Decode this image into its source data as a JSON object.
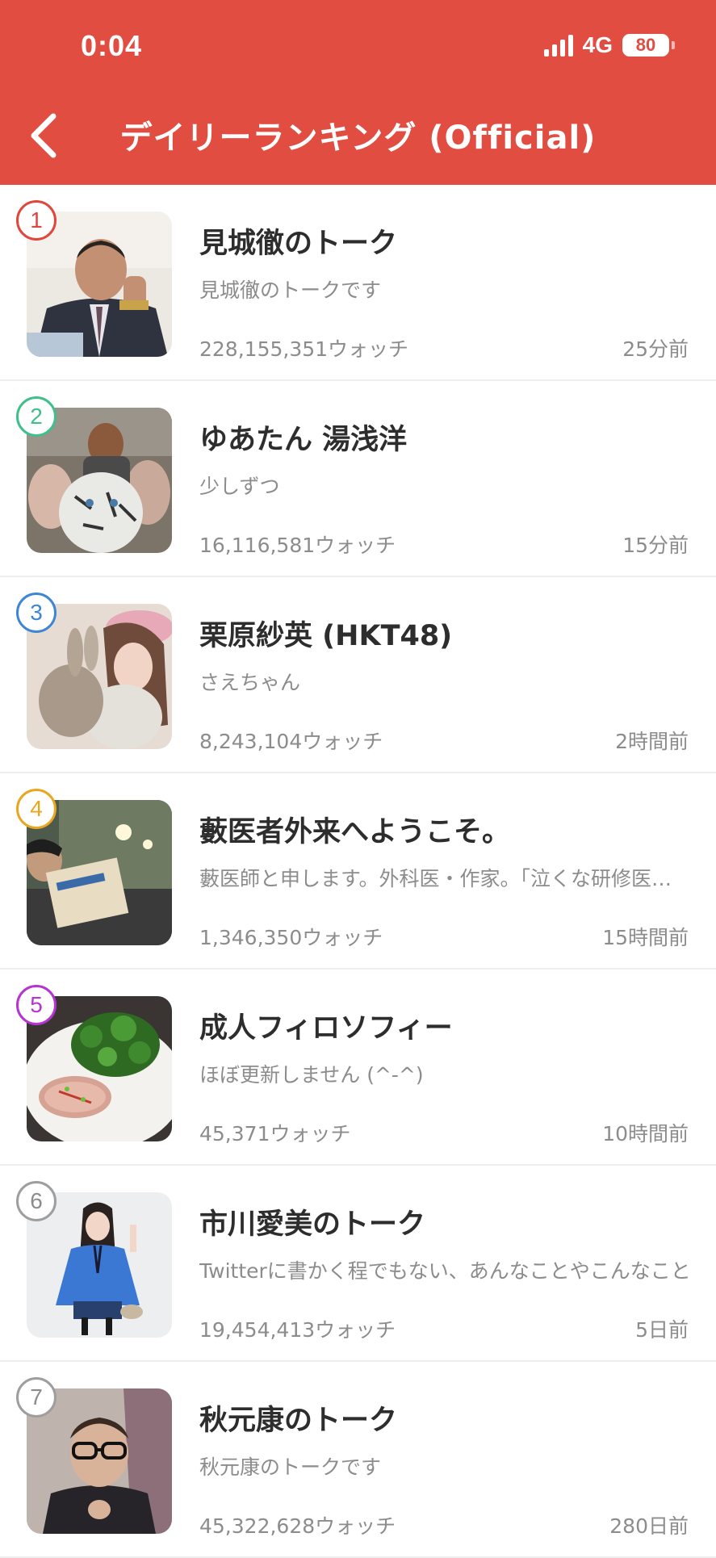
{
  "status_bar": {
    "time": "0:04",
    "network": "4G",
    "battery": "80"
  },
  "header": {
    "title": "デイリーランキング (Official)",
    "back_icon": "chevron-left-icon",
    "color": "#e14d40"
  },
  "rankings": [
    {
      "rank": "1",
      "rank_color": "#e0463b",
      "name": "見城徹のトーク",
      "description": "見城徹のトークです",
      "watchers": "228,155,351ウォッチ",
      "time_ago": "25分前"
    },
    {
      "rank": "2",
      "rank_color": "#3fbf8a",
      "name": "ゆあたん 湯浅洋",
      "description": "少しずつ",
      "watchers": "16,116,581ウォッチ",
      "time_ago": "15分前"
    },
    {
      "rank": "3",
      "rank_color": "#3d86d6",
      "name": "栗原紗英 (HKT48)",
      "description": "さえちゃん",
      "watchers": "8,243,104ウォッチ",
      "time_ago": "2時間前"
    },
    {
      "rank": "4",
      "rank_color": "#eaa620",
      "name": "藪医者外来へようこそ。",
      "description": "藪医師と申します。外科医・作家。「泣くな研修医」シリーズ(幻冬舎)",
      "watchers": "1,346,350ウォッチ",
      "time_ago": "15時間前"
    },
    {
      "rank": "5",
      "rank_color": "#b634d1",
      "name": "成人フィロソフィー",
      "description": "ほぼ更新しません (^-^)",
      "watchers": "45,371ウォッチ",
      "time_ago": "10時間前"
    },
    {
      "rank": "6",
      "rank_color": "#9e9e9e",
      "name": "市川愛美のトーク",
      "description": "Twitterに書かく程でもない、あんなことやこんなこと",
      "watchers": "19,454,413ウォッチ",
      "time_ago": "5日前"
    },
    {
      "rank": "7",
      "rank_color": "#9e9e9e",
      "name": "秋元康のトーク",
      "description": "秋元康のトークです",
      "watchers": "45,322,628ウォッチ",
      "time_ago": "280日前"
    }
  ]
}
